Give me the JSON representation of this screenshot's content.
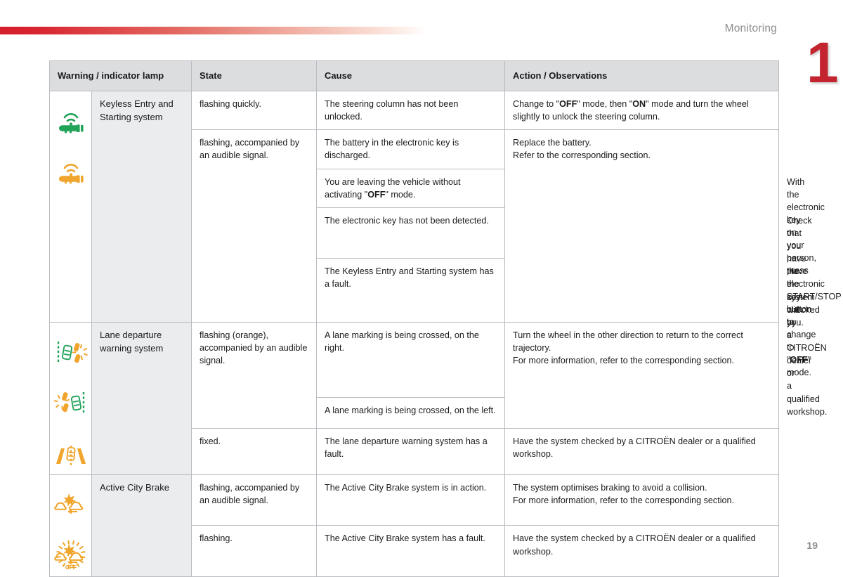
{
  "header": {
    "section_title": "Monitoring",
    "chapter_number": "1",
    "accent_color": "#d5202c",
    "chapter_tab_color": "#c3242f"
  },
  "page_number": "19",
  "table": {
    "columns": [
      "Warning / indicator lamp",
      "State",
      "Cause",
      "Action / Observations"
    ],
    "groups": [
      {
        "system": "Keyless Entry and Starting system",
        "icons": [
          {
            "name": "keyless-key-green-icon",
            "color": "#22a35a",
            "glyph": "key-with-waves"
          },
          {
            "name": "keyless-key-orange-icon",
            "color": "#f0a52c",
            "glyph": "key-with-waves"
          }
        ],
        "states": [
          {
            "state": "flashing quickly.",
            "rows": [
              {
                "cause": "The steering column has not been unlocked.",
                "action_html": "Change to \"<b>OFF</b>\" mode, then \"<b>ON</b>\" mode and turn the wheel slightly to unlock the steering column."
              }
            ]
          },
          {
            "state": "flashing, accompanied by an audible signal.",
            "rows": [
              {
                "cause": "The battery in the electronic key is discharged.",
                "action_html": "Replace the battery.<br>Refer to the corresponding section."
              },
              {
                "cause_html": "You are leaving the vehicle without activating \"<b>OFF</b>\" mode.",
                "action_html": "With the electronic key on your person, press the START/STOP button to change to \"<b>OFF</b>\" mode."
              },
              {
                "cause": "The electronic key has not been detected.",
                "action_html": "Check that you have the electronic key with you."
              },
              {
                "cause": "The Keyless Entry and Starting system has a fault.",
                "action_html": "Have the system checked by a CITROËN dealer or a qualified workshop."
              }
            ]
          }
        ]
      },
      {
        "system": "Lane departure warning system",
        "icons": [
          {
            "name": "lane-departure-right-icon",
            "color": "#f0a52c",
            "glyph": "lane-right"
          },
          {
            "name": "lane-departure-left-icon",
            "color": "#f0a52c",
            "glyph": "lane-left"
          },
          {
            "name": "lane-departure-fault-icon",
            "color": "#f0a52c",
            "glyph": "lane-fixed"
          }
        ],
        "states": [
          {
            "state": "flashing (orange), accompanied by an audible signal.",
            "rows": [
              {
                "cause": "A lane marking is being crossed, on the right.",
                "action_html": "Turn the wheel in the other direction to return to the correct trajectory.<br>For more information, refer to the corresponding section."
              },
              {
                "cause": "A lane marking is being crossed, on the left."
              }
            ]
          },
          {
            "state": "fixed.",
            "rows": [
              {
                "cause": "The lane departure warning system has a fault.",
                "action_html": "Have the system checked by a CITROËN dealer or a qualified workshop."
              }
            ]
          }
        ]
      },
      {
        "system": "Active City Brake",
        "icons": [
          {
            "name": "active-city-brake-icon",
            "color": "#f0a52c",
            "glyph": "collision"
          },
          {
            "name": "active-city-brake-off-icon",
            "color": "#f0a52c",
            "glyph": "collision-off",
            "label": "OFF"
          }
        ],
        "states": [
          {
            "state": "flashing, accompanied by an audible signal.",
            "rows": [
              {
                "cause": "The Active City Brake system is in action.",
                "action_html": "The system optimises braking to avoid a collision.<br>For more information, refer to the corresponding section."
              }
            ]
          },
          {
            "state": "flashing.",
            "rows": [
              {
                "cause": "The Active City Brake system has a fault.",
                "action_html": "Have the system checked by a CITROËN dealer or a qualified workshop."
              }
            ]
          }
        ]
      }
    ]
  }
}
